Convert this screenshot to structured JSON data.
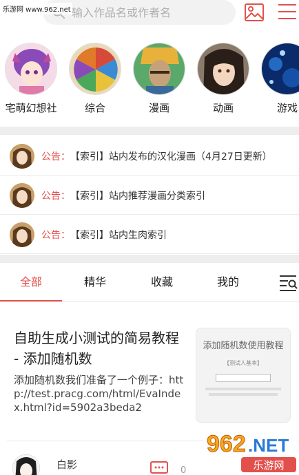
{
  "watermark_top": "乐游网 www.962.net",
  "search": {
    "placeholder": "输入作品名或作者名"
  },
  "colors": {
    "accent": "#e2504c",
    "divider": "#eeeeee"
  },
  "icons": {
    "search": "search-icon",
    "image": "image-icon",
    "menu": "menu-icon",
    "filter": "filter-list-icon",
    "comment": "comment-icon"
  },
  "categories": [
    {
      "label": "宅萌幻想社"
    },
    {
      "label": "综合"
    },
    {
      "label": "漫画"
    },
    {
      "label": "动画"
    },
    {
      "label": "游戏"
    }
  ],
  "notices": [
    {
      "tag": "公告：",
      "text": "【索引】站内发布的汉化漫画（4月27日更新）"
    },
    {
      "tag": "公告：",
      "text": "【索引】站内推荐漫画分类索引"
    },
    {
      "tag": "公告：",
      "text": "【索引】站内生肉索引"
    }
  ],
  "tabs": [
    {
      "label": "全部",
      "active": true
    },
    {
      "label": "精华"
    },
    {
      "label": "收藏"
    },
    {
      "label": "我的"
    }
  ],
  "post": {
    "title": "自助生成小测试的简易教程 - 添加随机数",
    "excerpt": "添加随机数我们准备了一个例子：http://test.pracg.com/html/EvaIndex.html?id=5902a3beda2",
    "thumb_title": "添加随机数使用教程",
    "thumb_sub": "【测试人基本】",
    "author": "白影",
    "comment_count": "0"
  },
  "watermark_bottom": {
    "number": "962",
    "suffix": ".NET",
    "cn": "乐游网"
  }
}
